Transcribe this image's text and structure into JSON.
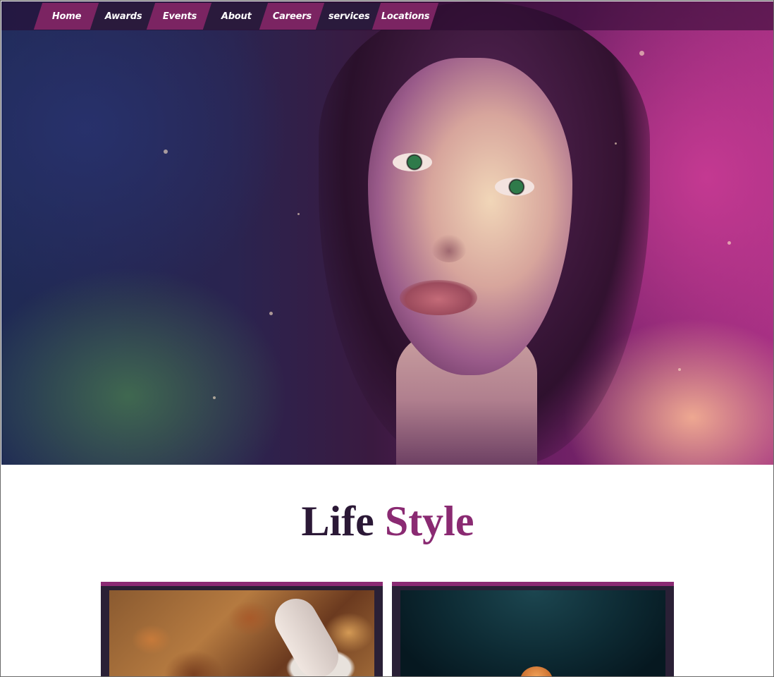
{
  "nav": {
    "items": [
      {
        "label": "Home"
      },
      {
        "label": "Awards"
      },
      {
        "label": "Events"
      },
      {
        "label": "About"
      },
      {
        "label": "Careers"
      },
      {
        "label": "services"
      },
      {
        "label": "Locations"
      }
    ]
  },
  "section": {
    "title_part1": "Life",
    "title_part2": "Style"
  },
  "colors": {
    "accent": "#8a2a72",
    "dark": "#2b1836",
    "nav_active": "#7b2462",
    "nav_alt": "#2a1a3c"
  }
}
